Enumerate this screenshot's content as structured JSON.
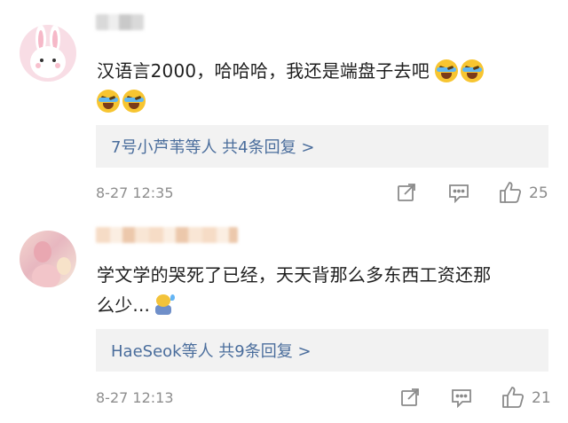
{
  "comments": [
    {
      "text": "汉语言2000，哈哈哈，我还是端盘子去吧",
      "emoji_count": 4,
      "reply_summary": "7号小芦苇等人 共4条回复 >",
      "timestamp": "8-27 12:35",
      "likes": "25"
    },
    {
      "text_line1": "学文学的哭死了已经，天天背那么多东西工资还那",
      "text_line2": "么少...",
      "reply_summary": "HaeSeok等人 共9条回复 >",
      "timestamp": "8-27 12:13",
      "likes": "21"
    }
  ],
  "icons": [
    "share-icon",
    "comment-icon",
    "thumbs-up-icon",
    "crying-laughing-emoji",
    "sweating-emoji"
  ]
}
